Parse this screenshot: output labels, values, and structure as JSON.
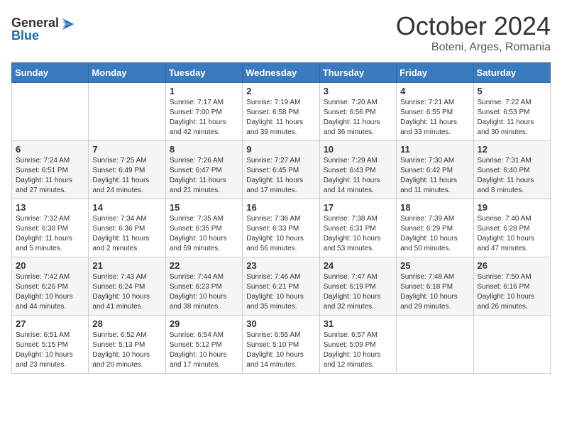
{
  "header": {
    "logo_line1": "General",
    "logo_line2": "Blue",
    "month": "October 2024",
    "location": "Boteni, Arges, Romania"
  },
  "days_of_week": [
    "Sunday",
    "Monday",
    "Tuesday",
    "Wednesday",
    "Thursday",
    "Friday",
    "Saturday"
  ],
  "weeks": [
    [
      {
        "day": "",
        "info": ""
      },
      {
        "day": "",
        "info": ""
      },
      {
        "day": "1",
        "info": "Sunrise: 7:17 AM\nSunset: 7:00 PM\nDaylight: 11 hours and 42 minutes."
      },
      {
        "day": "2",
        "info": "Sunrise: 7:19 AM\nSunset: 6:58 PM\nDaylight: 11 hours and 39 minutes."
      },
      {
        "day": "3",
        "info": "Sunrise: 7:20 AM\nSunset: 6:56 PM\nDaylight: 11 hours and 36 minutes."
      },
      {
        "day": "4",
        "info": "Sunrise: 7:21 AM\nSunset: 6:55 PM\nDaylight: 11 hours and 33 minutes."
      },
      {
        "day": "5",
        "info": "Sunrise: 7:22 AM\nSunset: 6:53 PM\nDaylight: 11 hours and 30 minutes."
      }
    ],
    [
      {
        "day": "6",
        "info": "Sunrise: 7:24 AM\nSunset: 6:51 PM\nDaylight: 11 hours and 27 minutes."
      },
      {
        "day": "7",
        "info": "Sunrise: 7:25 AM\nSunset: 6:49 PM\nDaylight: 11 hours and 24 minutes."
      },
      {
        "day": "8",
        "info": "Sunrise: 7:26 AM\nSunset: 6:47 PM\nDaylight: 11 hours and 21 minutes."
      },
      {
        "day": "9",
        "info": "Sunrise: 7:27 AM\nSunset: 6:45 PM\nDaylight: 11 hours and 17 minutes."
      },
      {
        "day": "10",
        "info": "Sunrise: 7:29 AM\nSunset: 6:43 PM\nDaylight: 11 hours and 14 minutes."
      },
      {
        "day": "11",
        "info": "Sunrise: 7:30 AM\nSunset: 6:42 PM\nDaylight: 11 hours and 11 minutes."
      },
      {
        "day": "12",
        "info": "Sunrise: 7:31 AM\nSunset: 6:40 PM\nDaylight: 11 hours and 8 minutes."
      }
    ],
    [
      {
        "day": "13",
        "info": "Sunrise: 7:32 AM\nSunset: 6:38 PM\nDaylight: 11 hours and 5 minutes."
      },
      {
        "day": "14",
        "info": "Sunrise: 7:34 AM\nSunset: 6:36 PM\nDaylight: 11 hours and 2 minutes."
      },
      {
        "day": "15",
        "info": "Sunrise: 7:35 AM\nSunset: 6:35 PM\nDaylight: 10 hours and 59 minutes."
      },
      {
        "day": "16",
        "info": "Sunrise: 7:36 AM\nSunset: 6:33 PM\nDaylight: 10 hours and 56 minutes."
      },
      {
        "day": "17",
        "info": "Sunrise: 7:38 AM\nSunset: 6:31 PM\nDaylight: 10 hours and 53 minutes."
      },
      {
        "day": "18",
        "info": "Sunrise: 7:39 AM\nSunset: 6:29 PM\nDaylight: 10 hours and 50 minutes."
      },
      {
        "day": "19",
        "info": "Sunrise: 7:40 AM\nSunset: 6:28 PM\nDaylight: 10 hours and 47 minutes."
      }
    ],
    [
      {
        "day": "20",
        "info": "Sunrise: 7:42 AM\nSunset: 6:26 PM\nDaylight: 10 hours and 44 minutes."
      },
      {
        "day": "21",
        "info": "Sunrise: 7:43 AM\nSunset: 6:24 PM\nDaylight: 10 hours and 41 minutes."
      },
      {
        "day": "22",
        "info": "Sunrise: 7:44 AM\nSunset: 6:23 PM\nDaylight: 10 hours and 38 minutes."
      },
      {
        "day": "23",
        "info": "Sunrise: 7:46 AM\nSunset: 6:21 PM\nDaylight: 10 hours and 35 minutes."
      },
      {
        "day": "24",
        "info": "Sunrise: 7:47 AM\nSunset: 6:19 PM\nDaylight: 10 hours and 32 minutes."
      },
      {
        "day": "25",
        "info": "Sunrise: 7:48 AM\nSunset: 6:18 PM\nDaylight: 10 hours and 29 minutes."
      },
      {
        "day": "26",
        "info": "Sunrise: 7:50 AM\nSunset: 6:16 PM\nDaylight: 10 hours and 26 minutes."
      }
    ],
    [
      {
        "day": "27",
        "info": "Sunrise: 6:51 AM\nSunset: 5:15 PM\nDaylight: 10 hours and 23 minutes."
      },
      {
        "day": "28",
        "info": "Sunrise: 6:52 AM\nSunset: 5:13 PM\nDaylight: 10 hours and 20 minutes."
      },
      {
        "day": "29",
        "info": "Sunrise: 6:54 AM\nSunset: 5:12 PM\nDaylight: 10 hours and 17 minutes."
      },
      {
        "day": "30",
        "info": "Sunrise: 6:55 AM\nSunset: 5:10 PM\nDaylight: 10 hours and 14 minutes."
      },
      {
        "day": "31",
        "info": "Sunrise: 6:57 AM\nSunset: 5:09 PM\nDaylight: 10 hours and 12 minutes."
      },
      {
        "day": "",
        "info": ""
      },
      {
        "day": "",
        "info": ""
      }
    ]
  ]
}
